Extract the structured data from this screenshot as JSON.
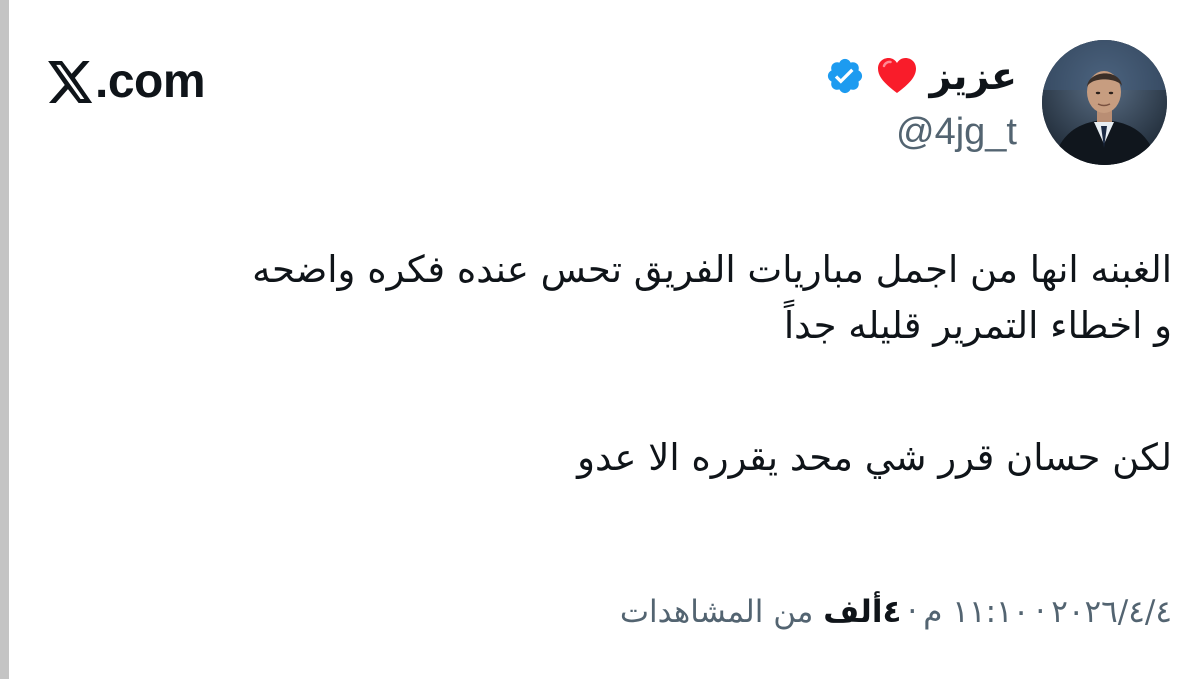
{
  "brand": {
    "text": ".com",
    "icon": "x-logo-icon"
  },
  "author": {
    "display_name": "عزيز",
    "emoji": "❤️",
    "handle": "@4jg_t",
    "verified": true,
    "verified_color": "#1d9bf0",
    "avatar_icon": "avatar-photo"
  },
  "tweet": {
    "lines": [
      "الغبنه انها من اجمل مباريات الفريق تحس عنده فكره واضحه",
      "و اخطاء التمرير قليله جداً",
      "لكن حسان قرر شي محد يقرره الا عدو"
    ]
  },
  "meta": {
    "date": "٢٠٢٦/٤/٤",
    "separator": "·",
    "time": "١١:١٠ م",
    "views_count": "٤ألف",
    "views_label": "من المشاهدات"
  },
  "colors": {
    "text": "#0f1419",
    "muted": "#536471",
    "heart": "#f91c2a",
    "left_rule": "#c4c4c4"
  }
}
